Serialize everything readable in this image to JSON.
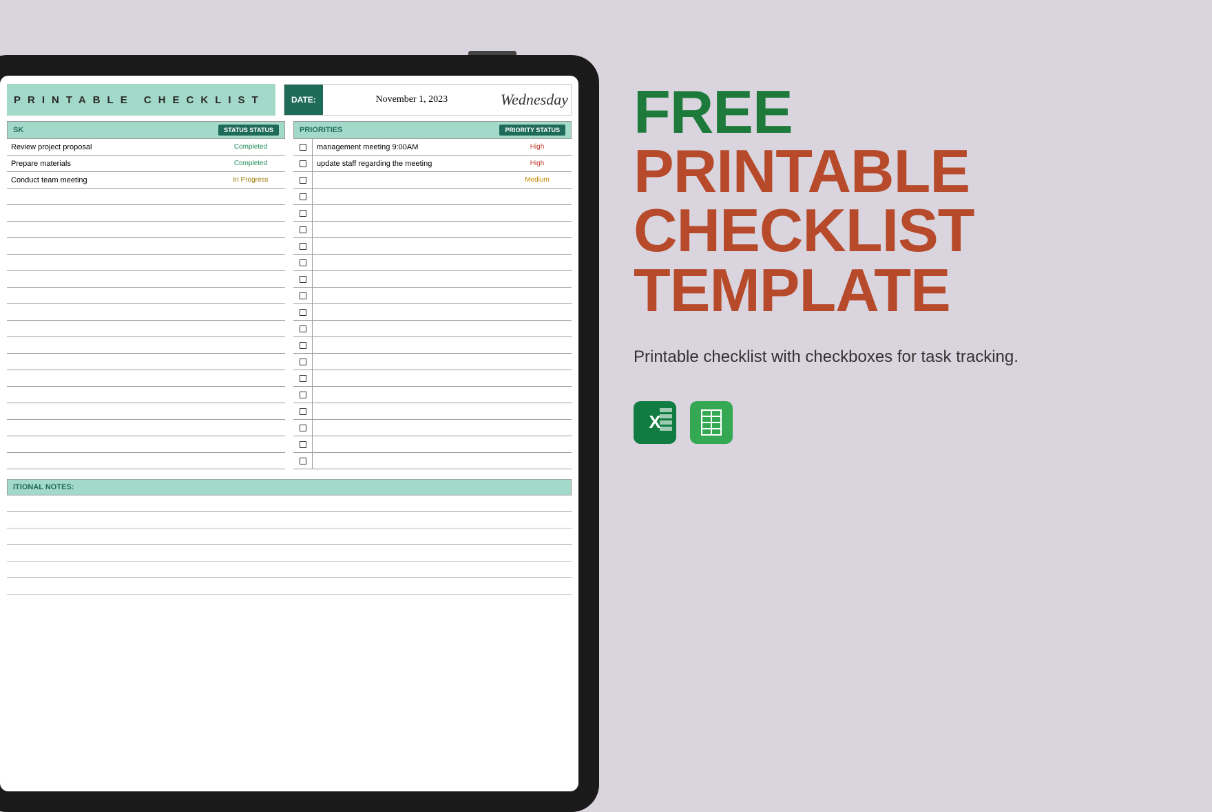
{
  "checklist": {
    "title": "PRINTABLE CHECKLIST",
    "date_label": "DATE:",
    "date_value": "November 1, 2023",
    "day": "Wednesday",
    "task_header": "SK",
    "task_status_header": "STATUS STATUS",
    "priorities_header": "PRIORITIES",
    "priority_status_header": "PRIORITY STATUS",
    "notes_header": "ITIONAL NOTES:",
    "tasks": [
      {
        "text": "Review project proposal",
        "status": "Completed",
        "status_class": "status-completed"
      },
      {
        "text": "Prepare materials",
        "status": "Completed",
        "status_class": "status-completed"
      },
      {
        "text": "Conduct team meeting",
        "status": "In Progress",
        "status_class": "status-in-progress"
      }
    ],
    "empty_task_rows": 17,
    "priorities": [
      {
        "text": "management meeting 9:00AM",
        "status": "High",
        "status_class": "prio-high"
      },
      {
        "text": "update staff regarding the meeting",
        "status": "High",
        "status_class": "prio-high"
      },
      {
        "text": "",
        "status": "Medium",
        "status_class": "prio-medium"
      }
    ],
    "empty_priority_rows": 17,
    "notes_lines": 6
  },
  "headline": {
    "free": "FREE",
    "line1": "PRINTABLE",
    "line2": "CHECKLIST",
    "line3": "TEMPLATE"
  },
  "subtitle": "Printable checklist with checkboxes for task tracking.",
  "icons": {
    "excel": "X",
    "sheets": "sheets"
  }
}
